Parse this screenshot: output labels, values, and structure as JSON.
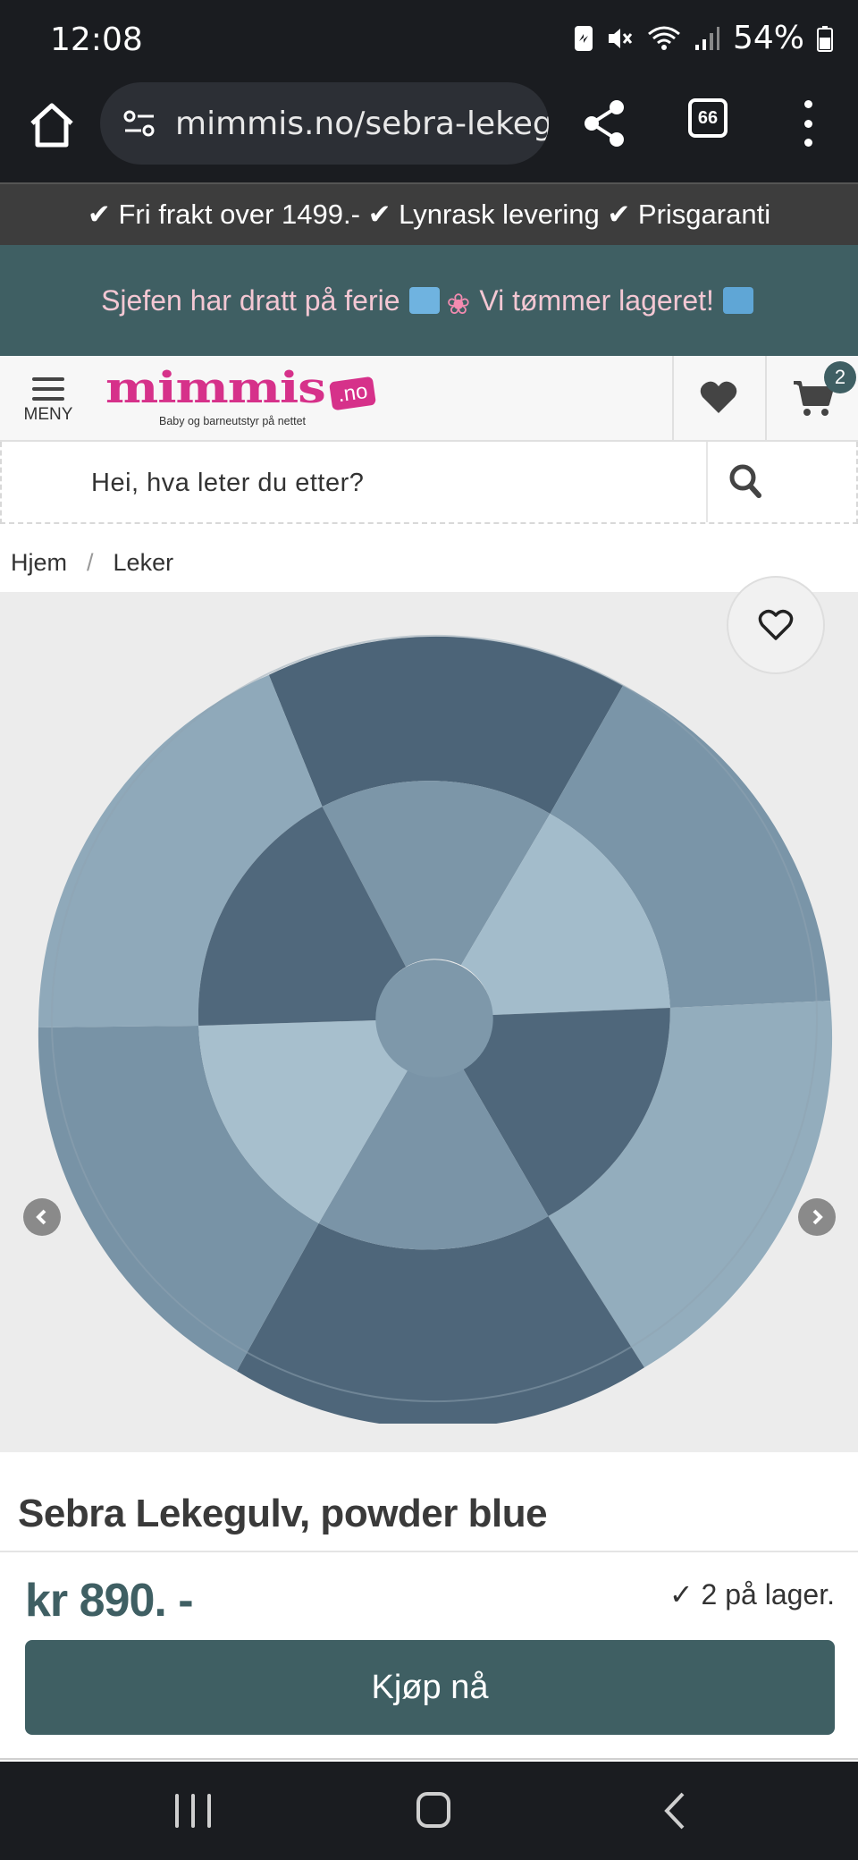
{
  "status_bar": {
    "time": "12:08",
    "battery": "54%"
  },
  "browser": {
    "url": "mimmis.no/sebra-lekegulv-powder-blue",
    "tab_count": "66"
  },
  "promo": {
    "usp_text": "✔ Fri frakt over 1499.- ✔ Lynrask levering ✔ Prisgaranti",
    "campaign_text_a": "Sjefen har dratt på ferie",
    "campaign_text_b": "Vi tømmer lageret!",
    "colors": {
      "usp_bg": "#3d3d3d",
      "campaign_bg": "#3f5f63",
      "campaign_text": "#f3c7d3"
    }
  },
  "header": {
    "menu_label": "MENY",
    "logo_text": "mimmis",
    "logo_suffix": ".no",
    "logo_tagline": "Baby og barneutstyr på nettet",
    "cart_count": "2",
    "brand_color": "#d6318a"
  },
  "search": {
    "placeholder": "Hei, hva leter du etter?"
  },
  "breadcrumb": {
    "items": [
      "Hjem",
      "Leker"
    ],
    "separator": "/"
  },
  "product": {
    "title": "Sebra Lekegulv, powder blue",
    "price": "kr 890. -",
    "stock": "✓ 2 på lager.",
    "buy_label": "Kjøp nå",
    "accent_color": "#3f5f63"
  },
  "icons": {
    "home": "home-icon",
    "tune": "site-settings-icon",
    "share": "share-icon",
    "more": "more-vert-icon",
    "menu": "hamburger-icon",
    "wishlist": "heart-icon",
    "cart": "cart-icon",
    "search": "search-icon",
    "favorite": "heart-outline-icon",
    "prev": "chevron-left-icon",
    "next": "chevron-right-icon"
  }
}
